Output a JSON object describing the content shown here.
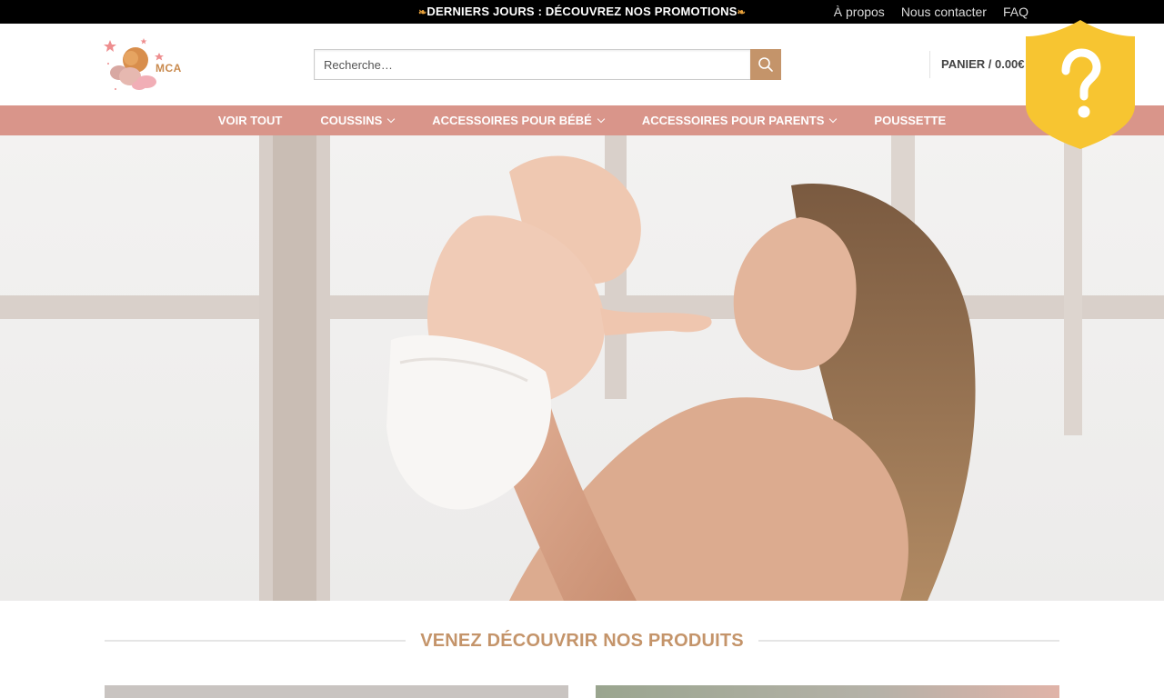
{
  "topbar": {
    "promo_text": "DERNIERS JOURS : DÉCOUVREZ NOS PROMOTIONS",
    "links": [
      "À propos",
      "Nous contacter",
      "FAQ"
    ]
  },
  "header": {
    "logo_text": "MCA",
    "search_placeholder": "Recherche…",
    "cart_label": "PANIER / 0.00€"
  },
  "nav": {
    "items": [
      {
        "label": "VOIR TOUT",
        "dropdown": false
      },
      {
        "label": "COUSSINS",
        "dropdown": true
      },
      {
        "label": "ACCESSOIRES POUR BÉBÉ",
        "dropdown": true
      },
      {
        "label": "ACCESSOIRES POUR PARENTS",
        "dropdown": true
      },
      {
        "label": "POUSSETTE",
        "dropdown": false
      }
    ]
  },
  "badge": {
    "symbol": "?",
    "color": "#f7c531"
  },
  "section": {
    "title": "VENEZ DÉCOUVRIR NOS PRODUITS"
  },
  "colors": {
    "accent": "#c4946a",
    "nav_bg": "#d9958a",
    "topbar_bg": "#000000"
  }
}
